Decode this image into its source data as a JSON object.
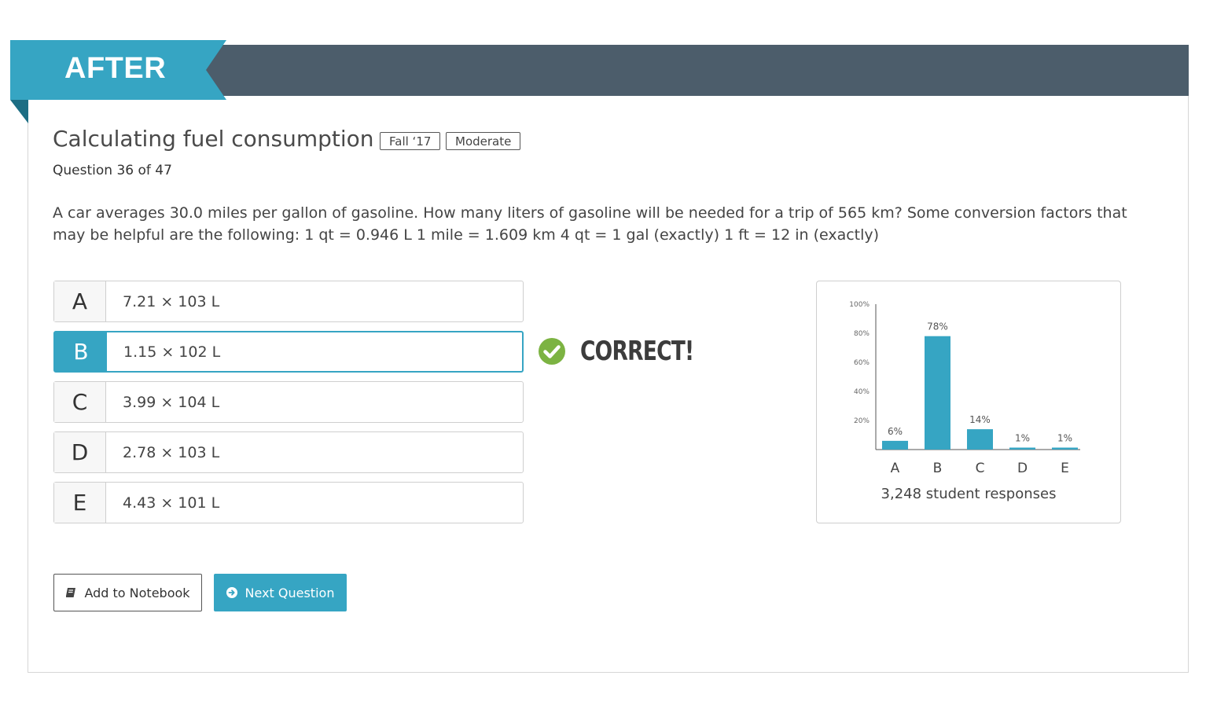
{
  "ribbon": {
    "label": "AFTER"
  },
  "question": {
    "title": "Calculating fuel consumption",
    "tags": [
      "Fall ‘17",
      "Moderate"
    ],
    "number_text": "Question 36 of 47",
    "text": "A car averages 30.0 miles per gallon of gasoline. How many liters of gasoline will be needed for a trip of 565 km? Some conversion factors that may be helpful are the following: 1 qt = 0.946 L 1 mile = 1.609 km 4 qt = 1 gal (exactly) 1 ft = 12 in (exactly)"
  },
  "options": [
    {
      "letter": "A",
      "value": "7.21 × 103 L",
      "selected": false
    },
    {
      "letter": "B",
      "value": "1.15 × 102 L",
      "selected": true
    },
    {
      "letter": "C",
      "value": "3.99 × 104 L",
      "selected": false
    },
    {
      "letter": "D",
      "value": "2.78 × 103 L",
      "selected": false
    },
    {
      "letter": "E",
      "value": "4.43 × 101 L",
      "selected": false
    }
  ],
  "feedback": {
    "label": "CORRECT!",
    "icon": "check-circle-icon",
    "color": "#7cb342"
  },
  "colors": {
    "accent": "#36a5c3",
    "header": "#4c5d6b",
    "ribbon_fold": "#1d6e84"
  },
  "chart_data": {
    "type": "bar",
    "categories": [
      "A",
      "B",
      "C",
      "D",
      "E"
    ],
    "values": [
      6,
      78,
      14,
      1,
      1
    ],
    "value_labels": [
      "6%",
      "78%",
      "14%",
      "1%",
      "1%"
    ],
    "y_ticks": [
      "20%",
      "40%",
      "60%",
      "80%",
      "100%"
    ],
    "ylim": [
      0,
      100
    ],
    "grid": false,
    "caption": "3,248 student responses"
  },
  "buttons": {
    "notebook_label": "Add to Notebook",
    "notebook_icon": "book-icon",
    "next_label": "Next Question",
    "next_icon": "arrow-circle-right-icon"
  }
}
